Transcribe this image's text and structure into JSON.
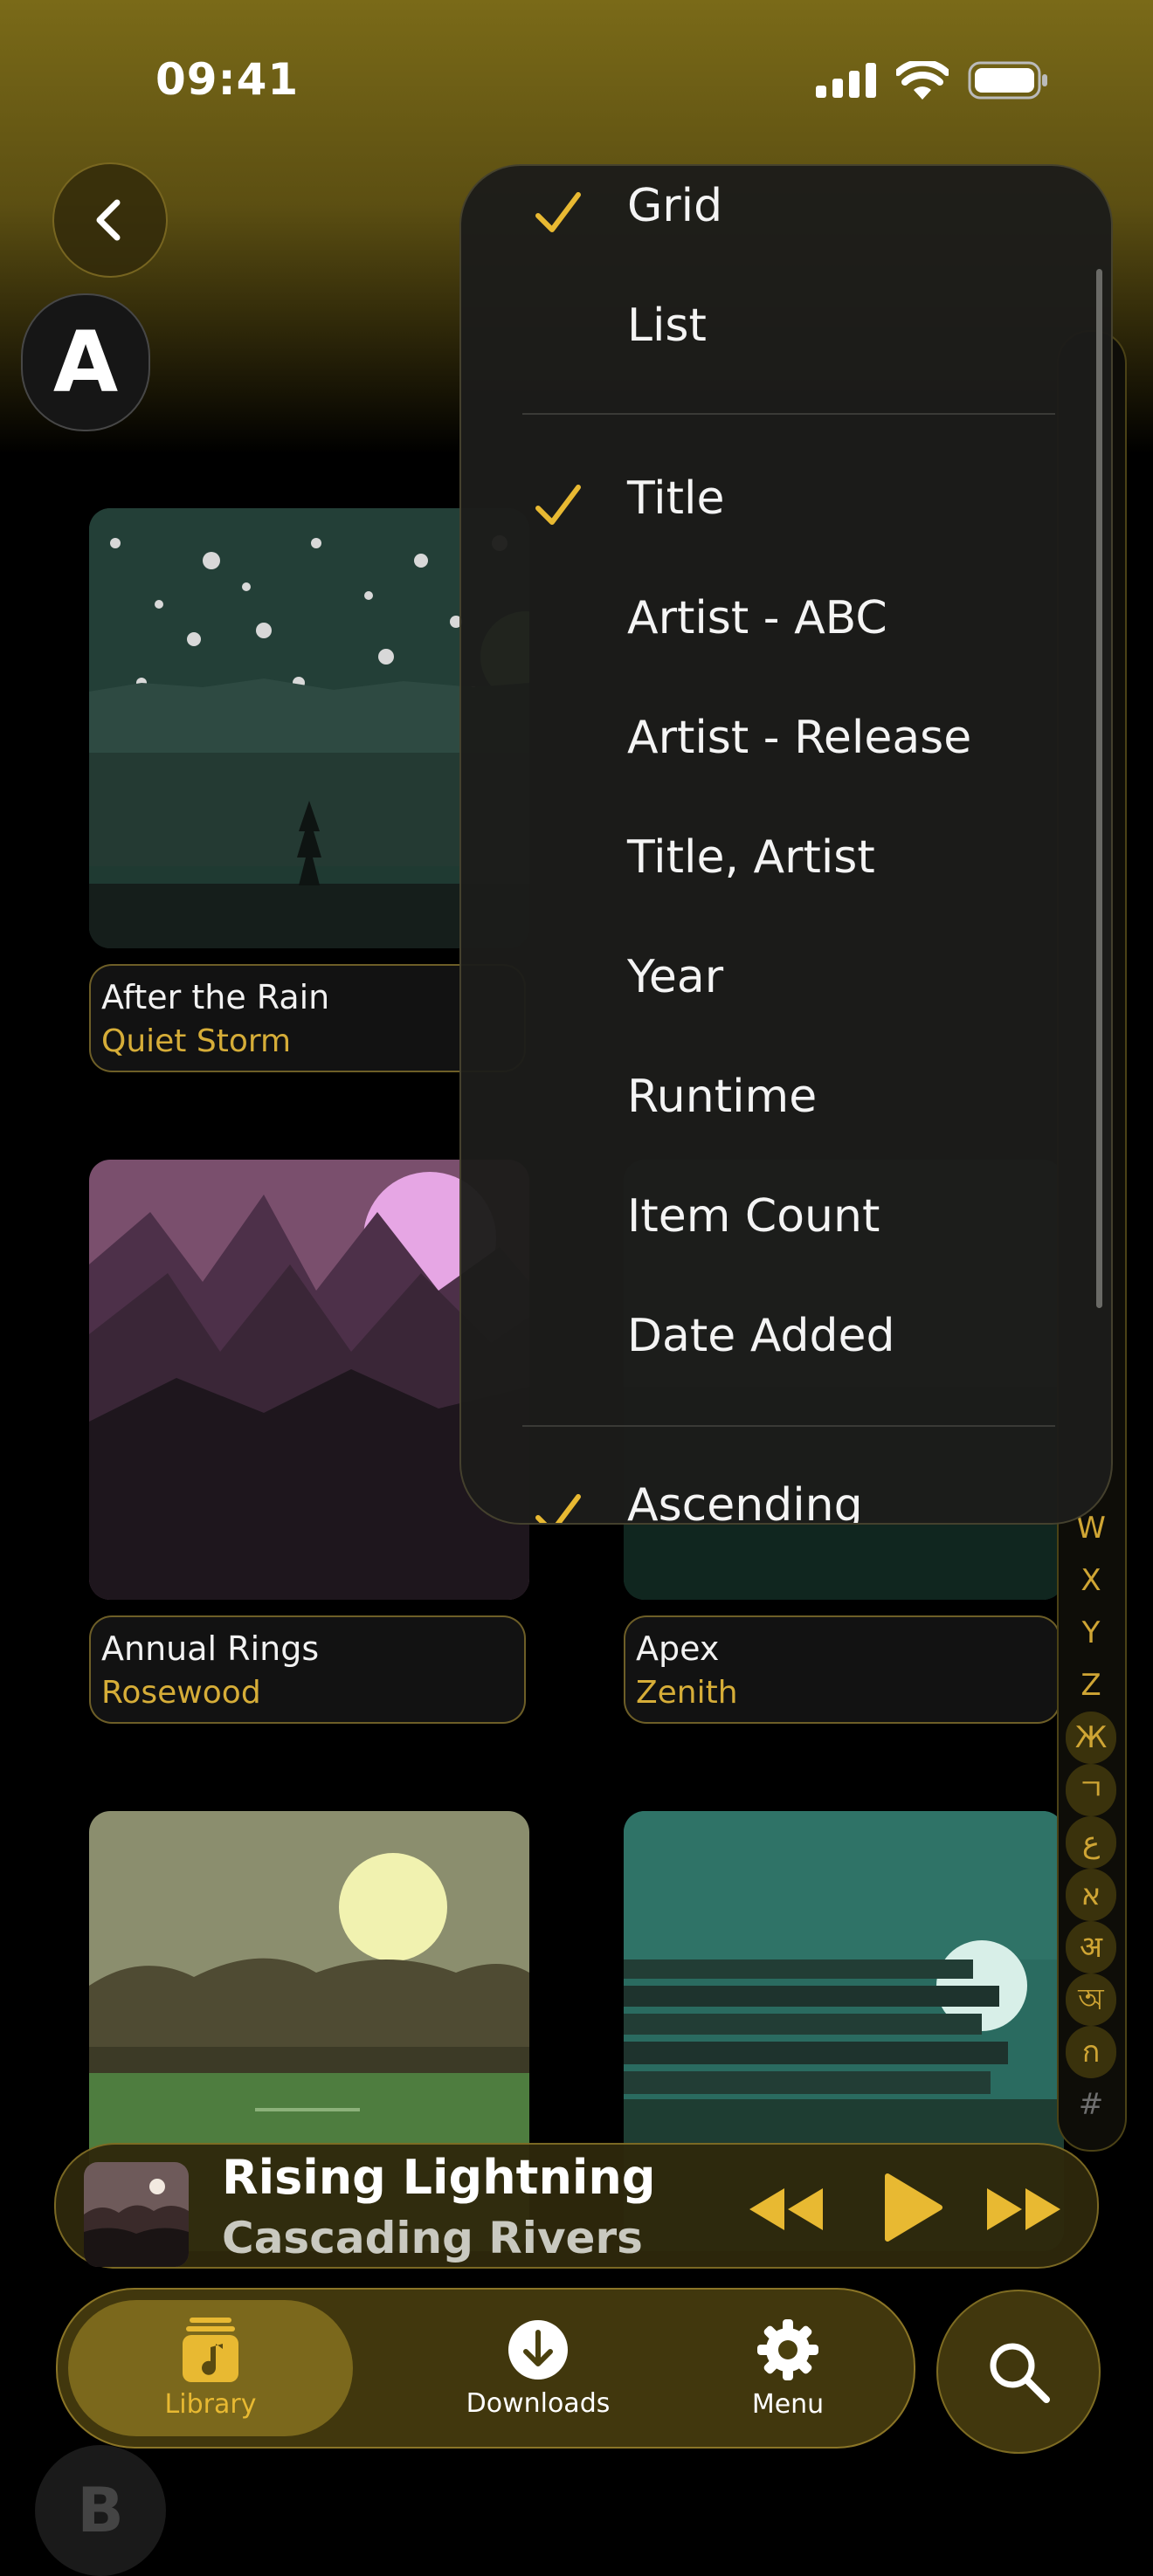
{
  "status_bar": {
    "time": "09:41"
  },
  "header": {
    "section_letter": "A"
  },
  "albums": [
    {
      "title": "After the Rain",
      "artist": "Quiet Storm"
    },
    {
      "title": "Annual Rings",
      "artist": "Rosewood"
    },
    {
      "title": "Apex",
      "artist": "Zenith"
    }
  ],
  "sort_menu": {
    "view_options": [
      {
        "label": "Grid",
        "checked": true
      },
      {
        "label": "List",
        "checked": false
      }
    ],
    "sort_options": [
      {
        "label": "Title",
        "checked": true
      },
      {
        "label": "Artist - ABC",
        "checked": false
      },
      {
        "label": "Artist - Release",
        "checked": false
      },
      {
        "label": "Title, Artist",
        "checked": false
      },
      {
        "label": "Year",
        "checked": false
      },
      {
        "label": "Runtime",
        "checked": false
      },
      {
        "label": "Item Count",
        "checked": false
      },
      {
        "label": "Date Added",
        "checked": false
      }
    ],
    "order_options": [
      {
        "label": "Ascending",
        "checked": true
      }
    ]
  },
  "index_letters": [
    "W",
    "X",
    "Y",
    "Z",
    "Ж",
    "ㄱ",
    "ع",
    "א",
    "अ",
    "অ",
    "ก",
    "#"
  ],
  "now_playing": {
    "title": "Rising Lightning",
    "artist": "Cascading Rivers"
  },
  "tabs": [
    {
      "label": "Library",
      "icon": "music-note-icon",
      "active": true
    },
    {
      "label": "Downloads",
      "icon": "download-icon",
      "active": false
    },
    {
      "label": "Menu",
      "icon": "gear-icon",
      "active": false
    }
  ],
  "colors": {
    "accent": "#E8B932",
    "header_gold": "#7A6A18",
    "background": "#000000"
  }
}
